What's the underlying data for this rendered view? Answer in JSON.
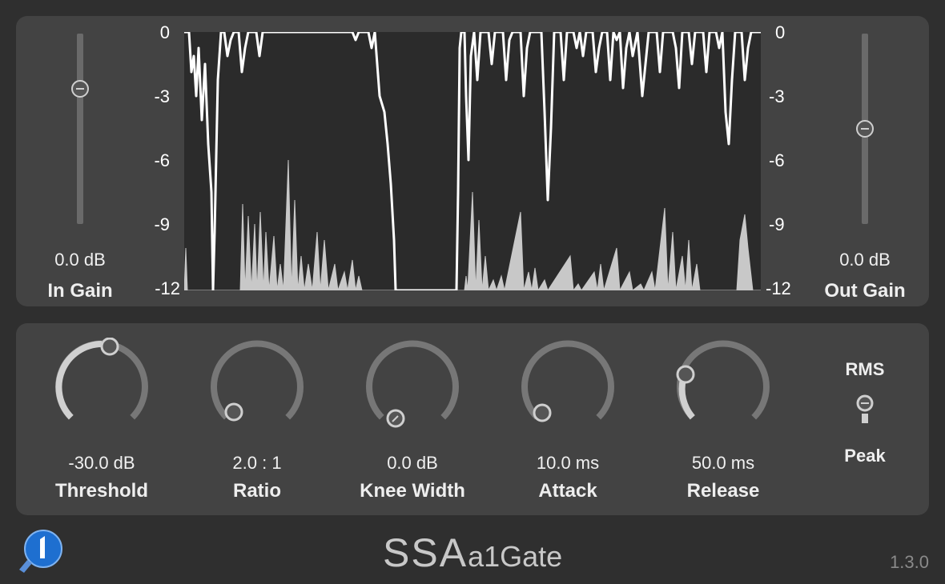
{
  "plugin": {
    "name_main": "SSA",
    "name_sub": "a1Gate",
    "version": "1.3.0",
    "brand_icon": "a1-logo-icon"
  },
  "meter": {
    "scale_labels": [
      "0",
      "-3",
      "-6",
      "-9",
      "-12"
    ],
    "scale_min_db": -12,
    "scale_max_db": 0,
    "colors": {
      "background": "#2b2b2b",
      "gain_reduction": "#ffffff",
      "input_level": "#c8c8c8"
    }
  },
  "in_gain": {
    "label": "In Gain",
    "value": "0.0 dB",
    "level": 0.75
  },
  "out_gain": {
    "label": "Out Gain",
    "value": "0.0 dB",
    "level": 0.5
  },
  "knobs": [
    {
      "id": "threshold",
      "label": "Threshold",
      "value": "-30.0 dB",
      "fraction": 0.5
    },
    {
      "id": "ratio",
      "label": "Ratio",
      "value": "2.0 : 1",
      "fraction": 0.0
    },
    {
      "id": "knee",
      "label": "Knee Width",
      "value": "0.0 dB",
      "fraction": 0.0
    },
    {
      "id": "attack",
      "label": "Attack",
      "value": "10.0 ms",
      "fraction": 0.02
    },
    {
      "id": "release",
      "label": "Release",
      "value": "50.0 ms",
      "fraction": 0.12
    }
  ],
  "detection": {
    "top_label": "RMS",
    "bottom_label": "Peak",
    "selected": "RMS"
  },
  "colors": {
    "panel": "#434343",
    "background": "#2f2f2f",
    "knob_track": "#777777",
    "knob_fill": "#d0d0d0"
  }
}
